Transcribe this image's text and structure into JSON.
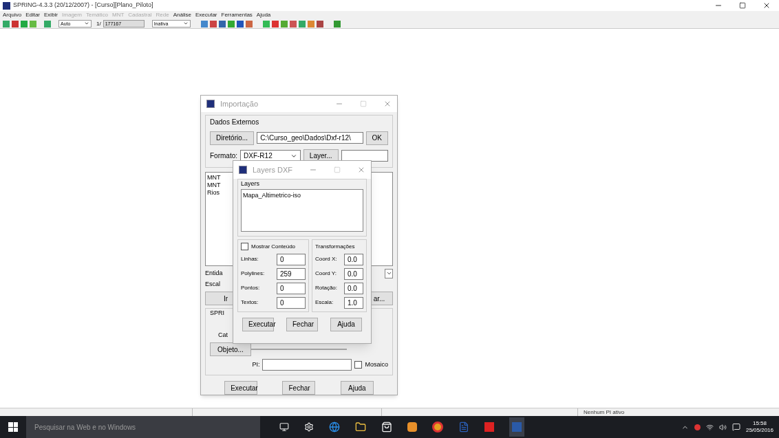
{
  "window": {
    "title": "SPRING-4.3.3 (20/12/2007) - [Curso][Plano_Piloto]"
  },
  "menu": [
    {
      "label": "Arquivo",
      "disabled": false
    },
    {
      "label": "Editar",
      "disabled": false
    },
    {
      "label": "Exibir",
      "disabled": false
    },
    {
      "label": "Imagem",
      "disabled": true
    },
    {
      "label": "Temático",
      "disabled": true
    },
    {
      "label": "MNT",
      "disabled": true
    },
    {
      "label": "Cadastral",
      "disabled": true
    },
    {
      "label": "Rede",
      "disabled": true
    },
    {
      "label": "Análise",
      "disabled": false
    },
    {
      "label": "Executar",
      "disabled": false
    },
    {
      "label": "Ferramentas",
      "disabled": false
    },
    {
      "label": "Ajuda",
      "disabled": false
    }
  ],
  "toolbar": {
    "scale_combo": "Auto",
    "page_label": "1/",
    "page_field": "177167",
    "mode_combo": "Inativa"
  },
  "import_dialog": {
    "title": "Importação",
    "group": "Dados Externos",
    "directory_button": "Diretório...",
    "directory_field": "C:\\Curso_geo\\Dados\\Dxf-r12\\",
    "ok_button": "OK",
    "format_label": "Formato:",
    "format_combo": "DXF-R12",
    "layer_button": "Layer...",
    "files": [
      "MNT",
      "MNT",
      "Rios"
    ],
    "entity_label": "Entida",
    "scale_label": "Escal",
    "left_button": "Ir",
    "right_button": "ar...",
    "spring_group": "SPRI",
    "category_label": "Cat",
    "object_button": "Objeto...",
    "pi_label": "PI:",
    "mosaic": {
      "label": "Mosaico",
      "checked": false
    },
    "buttons": [
      "Executar",
      "Fechar",
      "Ajuda"
    ]
  },
  "layers_dialog": {
    "title": "Layers DXF",
    "group": "Layers",
    "layers": [
      {
        "name": "Mapa_Altimetrico-iso",
        "selected": false
      }
    ],
    "show_content": {
      "label": "Mostrar Conteúdo",
      "checked": false
    },
    "counts": [
      {
        "label": "Linhas:",
        "value": "0"
      },
      {
        "label": "Polylines:",
        "value": "259"
      },
      {
        "label": "Pontos:",
        "value": "0"
      },
      {
        "label": "Textos:",
        "value": "0"
      }
    ],
    "transform_group": "Transformações",
    "transforms": [
      {
        "label": "Coord X:",
        "value": "0.0"
      },
      {
        "label": "Coord Y:",
        "value": "0.0"
      },
      {
        "label": "Rotação:",
        "value": "0.0"
      },
      {
        "label": "Escala:",
        "value": "1.0"
      }
    ],
    "buttons": [
      "Executar",
      "Fechar",
      "Ajuda"
    ]
  },
  "status_bar": {
    "message": "Nenhum PI ativo"
  },
  "taskbar": {
    "search_placeholder": "Pesquisar na Web e no Windows",
    "time": "15:58",
    "date": "25/05/2016"
  }
}
